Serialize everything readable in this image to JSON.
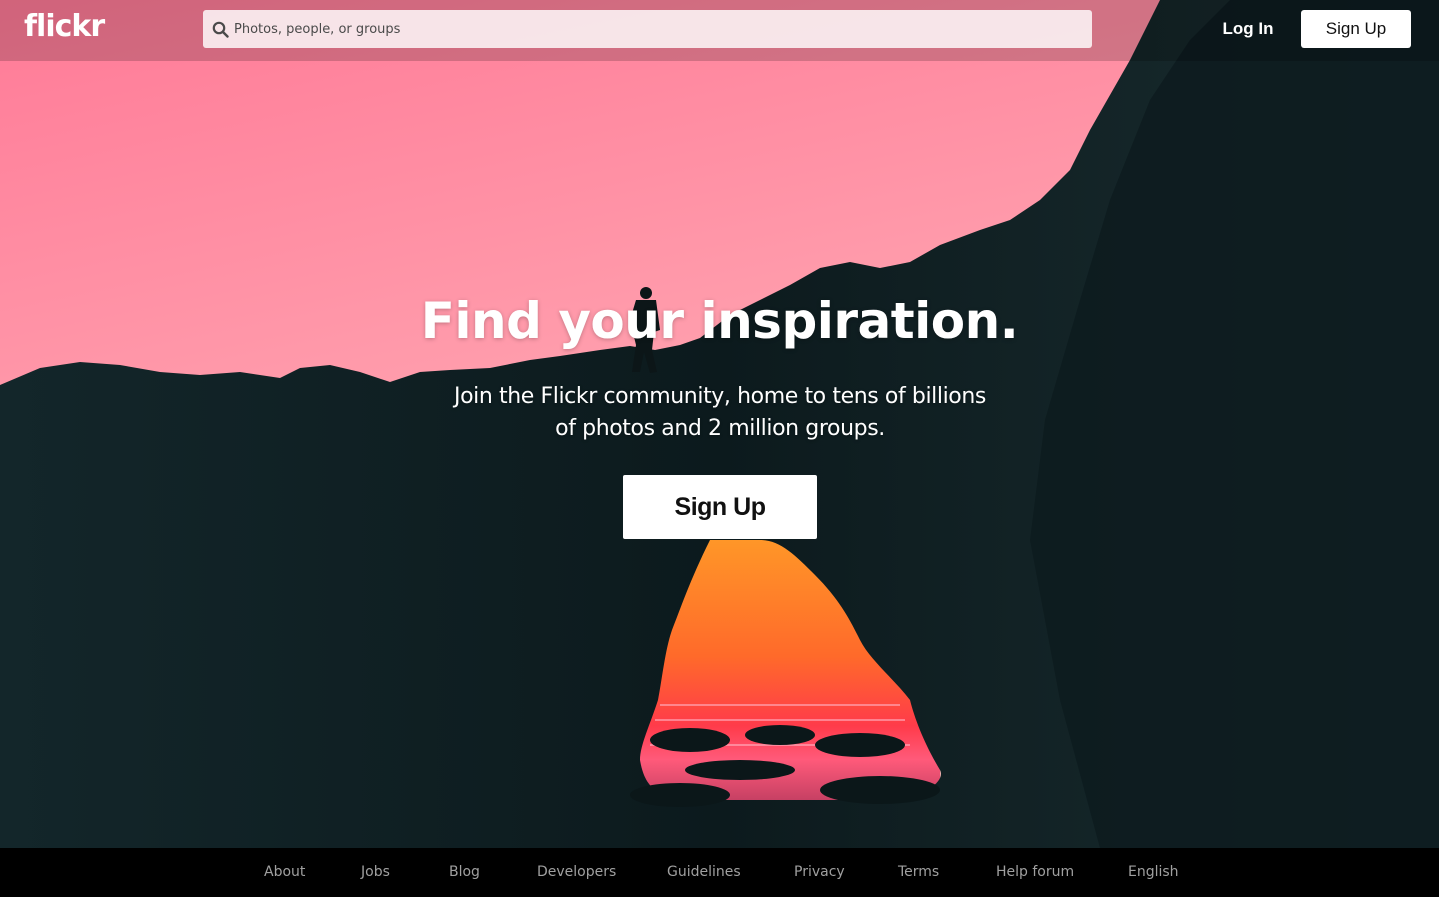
{
  "header": {
    "logo": "flickr",
    "search_placeholder": "Photos, people, or groups",
    "login_label": "Log In",
    "signup_label": "Sign Up"
  },
  "hero": {
    "headline": "Find your inspiration.",
    "subhead_line1": "Join the Flickr community, home to tens of billions",
    "subhead_line2": "of photos and 2 million groups.",
    "cta_label": "Sign Up"
  },
  "footer": {
    "links": [
      "About",
      "Jobs",
      "Blog",
      "Developers",
      "Guidelines",
      "Privacy",
      "Terms",
      "Help forum",
      "English"
    ]
  },
  "colors": {
    "sky_top": "#ff7a95",
    "sky_bottom": "#ffb2b6",
    "rock": "#0f1f22",
    "sunset": "#ff6a2a"
  }
}
